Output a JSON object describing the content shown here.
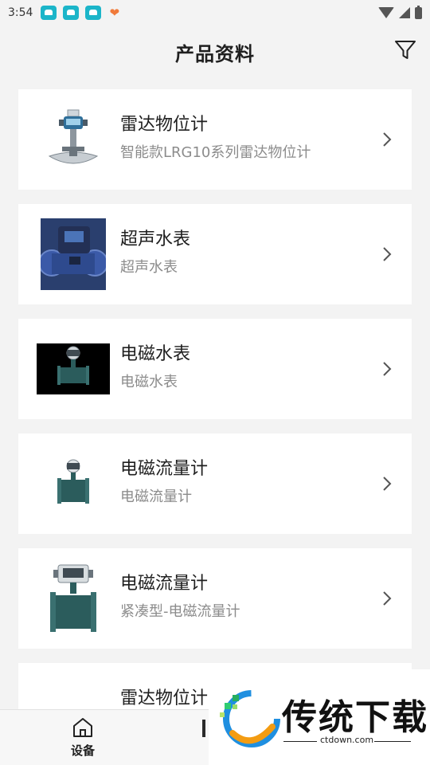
{
  "status_bar": {
    "time": "3:54"
  },
  "header": {
    "title": "产品资料"
  },
  "products": [
    {
      "title": "雷达物位计",
      "subtitle": "智能款LRG10系列雷达物位计",
      "thumb": "radar-level-meter"
    },
    {
      "title": "超声水表",
      "subtitle": "超声水表",
      "thumb": "ultrasonic-water-meter"
    },
    {
      "title": "电磁水表",
      "subtitle": "电磁水表",
      "thumb": "electromagnetic-water-meter"
    },
    {
      "title": "电磁流量计",
      "subtitle": "电磁流量计",
      "thumb": "electromagnetic-flowmeter"
    },
    {
      "title": "电磁流量计",
      "subtitle": "紧凑型-电磁流量计",
      "thumb": "compact-electromagnetic-flowmeter"
    },
    {
      "title": "雷达物位计",
      "subtitle": "",
      "thumb": ""
    }
  ],
  "bottom_nav": {
    "devices_label": "设备"
  },
  "watermark": {
    "brand": "传统下载",
    "domain": "ctdown.com"
  },
  "colors": {
    "accent": "#1bb5c9",
    "subtitle": "#8c8c8c",
    "background": "#f3f3f3"
  }
}
